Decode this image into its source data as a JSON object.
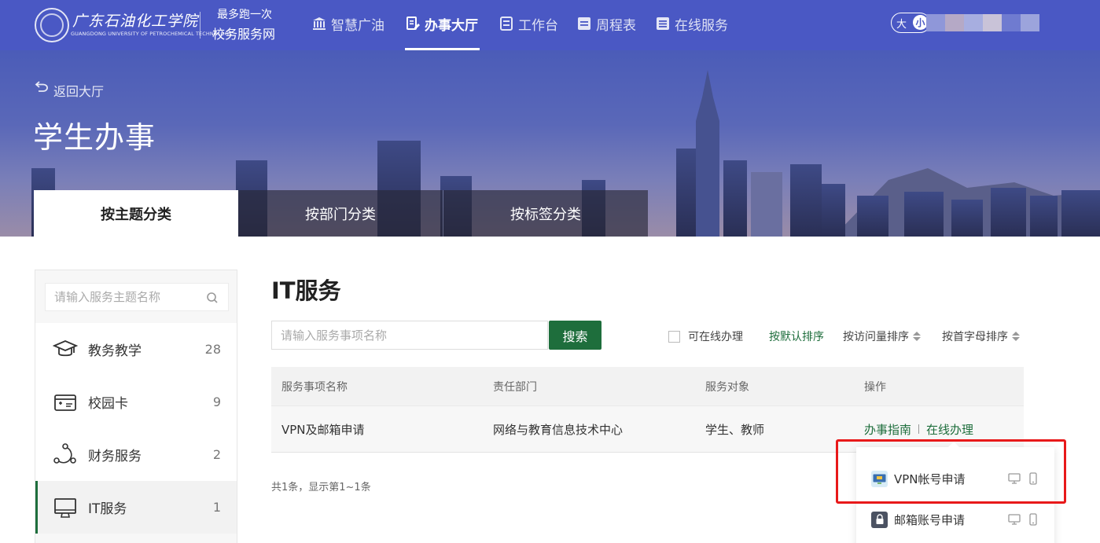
{
  "header": {
    "school_name": "广东石油化工学院",
    "school_name_en": "GUANGDONG UNIVERSITY OF PETROCHEMICAL TECHNOLOGY",
    "slogan_line1": "最多跑一次",
    "slogan_line2": "校务服务网",
    "nav": [
      {
        "label": "智慧广油",
        "icon": "bank-icon"
      },
      {
        "label": "办事大厅",
        "icon": "document-edit-icon",
        "active": true
      },
      {
        "label": "工作台",
        "icon": "workbench-icon"
      },
      {
        "label": "周程表",
        "icon": "calendar-list-icon"
      },
      {
        "label": "在线服务",
        "icon": "service-list-icon"
      }
    ],
    "font_size_label": "大",
    "font_size_knob": "小"
  },
  "banner": {
    "back_label": "返回大厅",
    "title": "学生办事",
    "tabs": [
      {
        "label": "按主题分类",
        "active": true
      },
      {
        "label": "按部门分类"
      },
      {
        "label": "按标签分类"
      }
    ]
  },
  "sidebar": {
    "search_placeholder": "请输入服务主题名称",
    "items": [
      {
        "label": "教务教学",
        "count": "28",
        "icon": "graduation-cap-icon"
      },
      {
        "label": "校园卡",
        "count": "9",
        "icon": "campus-card-icon"
      },
      {
        "label": "财务服务",
        "count": "2",
        "icon": "finance-network-icon"
      },
      {
        "label": "IT服务",
        "count": "1",
        "icon": "monitor-icon",
        "active": true
      }
    ]
  },
  "main": {
    "title": "IT服务",
    "search_placeholder": "请输入服务事项名称",
    "search_button": "搜索",
    "online_filter_label": "可在线办理",
    "sort_default": "按默认排序",
    "sort_visits": "按访问量排序",
    "sort_alpha": "按首字母排序",
    "table": {
      "headers": [
        "服务事项名称",
        "责任部门",
        "服务对象",
        "操作"
      ],
      "rows": [
        {
          "name": "VPN及邮箱申请",
          "dept": "网络与教育信息技术中心",
          "target": "学生、教师",
          "guide": "办事指南",
          "online": "在线办理"
        }
      ]
    },
    "pager_info": "共1条，显示第1~1条"
  },
  "popup": {
    "items": [
      {
        "label": "VPN帐号申请",
        "icon": "vpn-icon"
      },
      {
        "label": "邮箱账号申请",
        "icon": "lock-icon"
      }
    ]
  },
  "colors": {
    "nav_bg": "#4a58c4",
    "accent_green": "#1e6e3c",
    "highlight_red": "#e8191a"
  }
}
